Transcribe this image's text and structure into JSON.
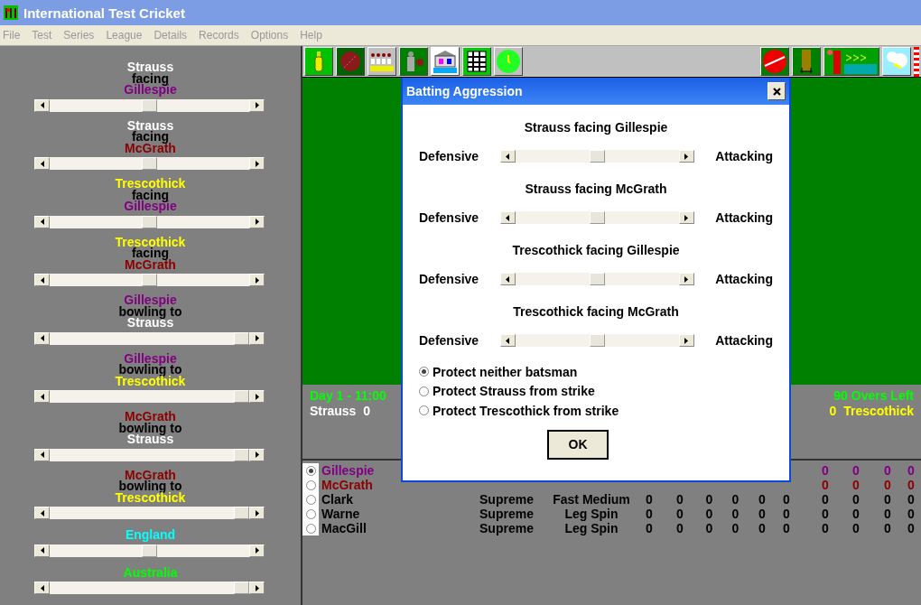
{
  "window": {
    "title": "International Test Cricket"
  },
  "menu": [
    "File",
    "Test",
    "Series",
    "League",
    "Details",
    "Records",
    "Options",
    "Help"
  ],
  "matchups": [
    {
      "lines": [
        {
          "text": "Strauss",
          "color": "#ffffff"
        },
        {
          "text": "facing",
          "color": "#000000"
        },
        {
          "text": "Gillespie",
          "color": "#800080"
        }
      ],
      "level": 0.5
    },
    {
      "lines": [
        {
          "text": "Strauss",
          "color": "#ffffff"
        },
        {
          "text": "facing",
          "color": "#000000"
        },
        {
          "text": "McGrath",
          "color": "#8b0000"
        }
      ],
      "level": 0.5
    },
    {
      "lines": [
        {
          "text": "Trescothick",
          "color": "#ffff00"
        },
        {
          "text": "facing",
          "color": "#000000"
        },
        {
          "text": "Gillespie",
          "color": "#800080"
        }
      ],
      "level": 0.5
    },
    {
      "lines": [
        {
          "text": "Trescothick",
          "color": "#ffff00"
        },
        {
          "text": "facing",
          "color": "#000000"
        },
        {
          "text": "McGrath",
          "color": "#8b0000"
        }
      ],
      "level": 0.5
    },
    {
      "lines": [
        {
          "text": "Gillespie",
          "color": "#800080"
        },
        {
          "text": "bowling to",
          "color": "#000000"
        },
        {
          "text": "Strauss",
          "color": "#ffffff"
        }
      ],
      "level": 1
    },
    {
      "lines": [
        {
          "text": "Gillespie",
          "color": "#800080"
        },
        {
          "text": "bowling to",
          "color": "#000000"
        },
        {
          "text": "Trescothick",
          "color": "#ffff00"
        }
      ],
      "level": 1
    },
    {
      "lines": [
        {
          "text": "McGrath",
          "color": "#8b0000"
        },
        {
          "text": "bowling to",
          "color": "#000000"
        },
        {
          "text": "Strauss",
          "color": "#ffffff"
        }
      ],
      "level": 1
    },
    {
      "lines": [
        {
          "text": "McGrath",
          "color": "#8b0000"
        },
        {
          "text": "bowling to",
          "color": "#000000"
        },
        {
          "text": "Trescothick",
          "color": "#ffff00"
        }
      ],
      "level": 1
    },
    {
      "lines": [
        {
          "text": "England",
          "color": "#00ffff"
        }
      ],
      "level": 0.5
    },
    {
      "lines": [
        {
          "text": "Australia",
          "color": "#00ff00"
        }
      ],
      "level": 1
    }
  ],
  "toolbar_left": [
    {
      "kind": "bat"
    },
    {
      "kind": "ball"
    },
    {
      "kind": "crowd"
    },
    {
      "kind": "player"
    },
    {
      "kind": "pavilion"
    },
    {
      "kind": "scoreboard"
    },
    {
      "kind": "clock"
    }
  ],
  "toolbar_right": [
    {
      "kind": "ball"
    },
    {
      "kind": "wicket"
    },
    {
      "kind": "pitch"
    },
    {
      "kind": "sky"
    }
  ],
  "score": {
    "day": "Day 1 - 11:00",
    "batsman_1": "Strauss",
    "batsman_1_runs": "0",
    "overs_left": "90 Overs Left",
    "batsman_2_runs": "0",
    "batsman_2": "Trescothick"
  },
  "bowlers": [
    {
      "name": "Gillespie",
      "color": "#800080",
      "selected": true,
      "cells": [
        null,
        null,
        null,
        null,
        null,
        null,
        null,
        null,
        "0",
        "0",
        "0",
        "0"
      ]
    },
    {
      "name": "McGrath",
      "color": "#8b0000",
      "selected": false,
      "cells": [
        null,
        null,
        null,
        null,
        null,
        null,
        null,
        null,
        "0",
        "0",
        "0",
        "0"
      ]
    },
    {
      "name": "Clark",
      "color": "#000000",
      "selected": false,
      "cells": [
        "Supreme",
        "Fast Medium",
        "0",
        "0",
        "0",
        "0",
        "0",
        "0",
        "0",
        "0",
        "0",
        "0"
      ]
    },
    {
      "name": "Warne",
      "color": "#000000",
      "selected": false,
      "cells": [
        "Supreme",
        "Leg Spin",
        "0",
        "0",
        "0",
        "0",
        "0",
        "0",
        "0",
        "0",
        "0",
        "0"
      ]
    },
    {
      "name": "MacGill",
      "color": "#000000",
      "selected": false,
      "cells": [
        "Supreme",
        "Leg Spin",
        "0",
        "0",
        "0",
        "0",
        "0",
        "0",
        "0",
        "0",
        "0",
        "0"
      ]
    }
  ],
  "dialog": {
    "title": "Batting Aggression",
    "sliders": [
      {
        "heading": "Strauss facing Gillespie",
        "low_label": "Defensive",
        "high_label": "Attacking",
        "level": 0.5
      },
      {
        "heading": "Strauss facing McGrath",
        "low_label": "Defensive",
        "high_label": "Attacking",
        "level": 0.5
      },
      {
        "heading": "Trescothick facing Gillespie",
        "low_label": "Defensive",
        "high_label": "Attacking",
        "level": 0.5
      },
      {
        "heading": "Trescothick facing McGrath",
        "low_label": "Defensive",
        "high_label": "Attacking",
        "level": 0.5
      }
    ],
    "options": [
      {
        "label": "Protect neither batsman",
        "selected": true
      },
      {
        "label": "Protect Strauss from strike",
        "selected": false
      },
      {
        "label": "Protect Trescothick from strike",
        "selected": false
      }
    ],
    "ok": "OK"
  }
}
